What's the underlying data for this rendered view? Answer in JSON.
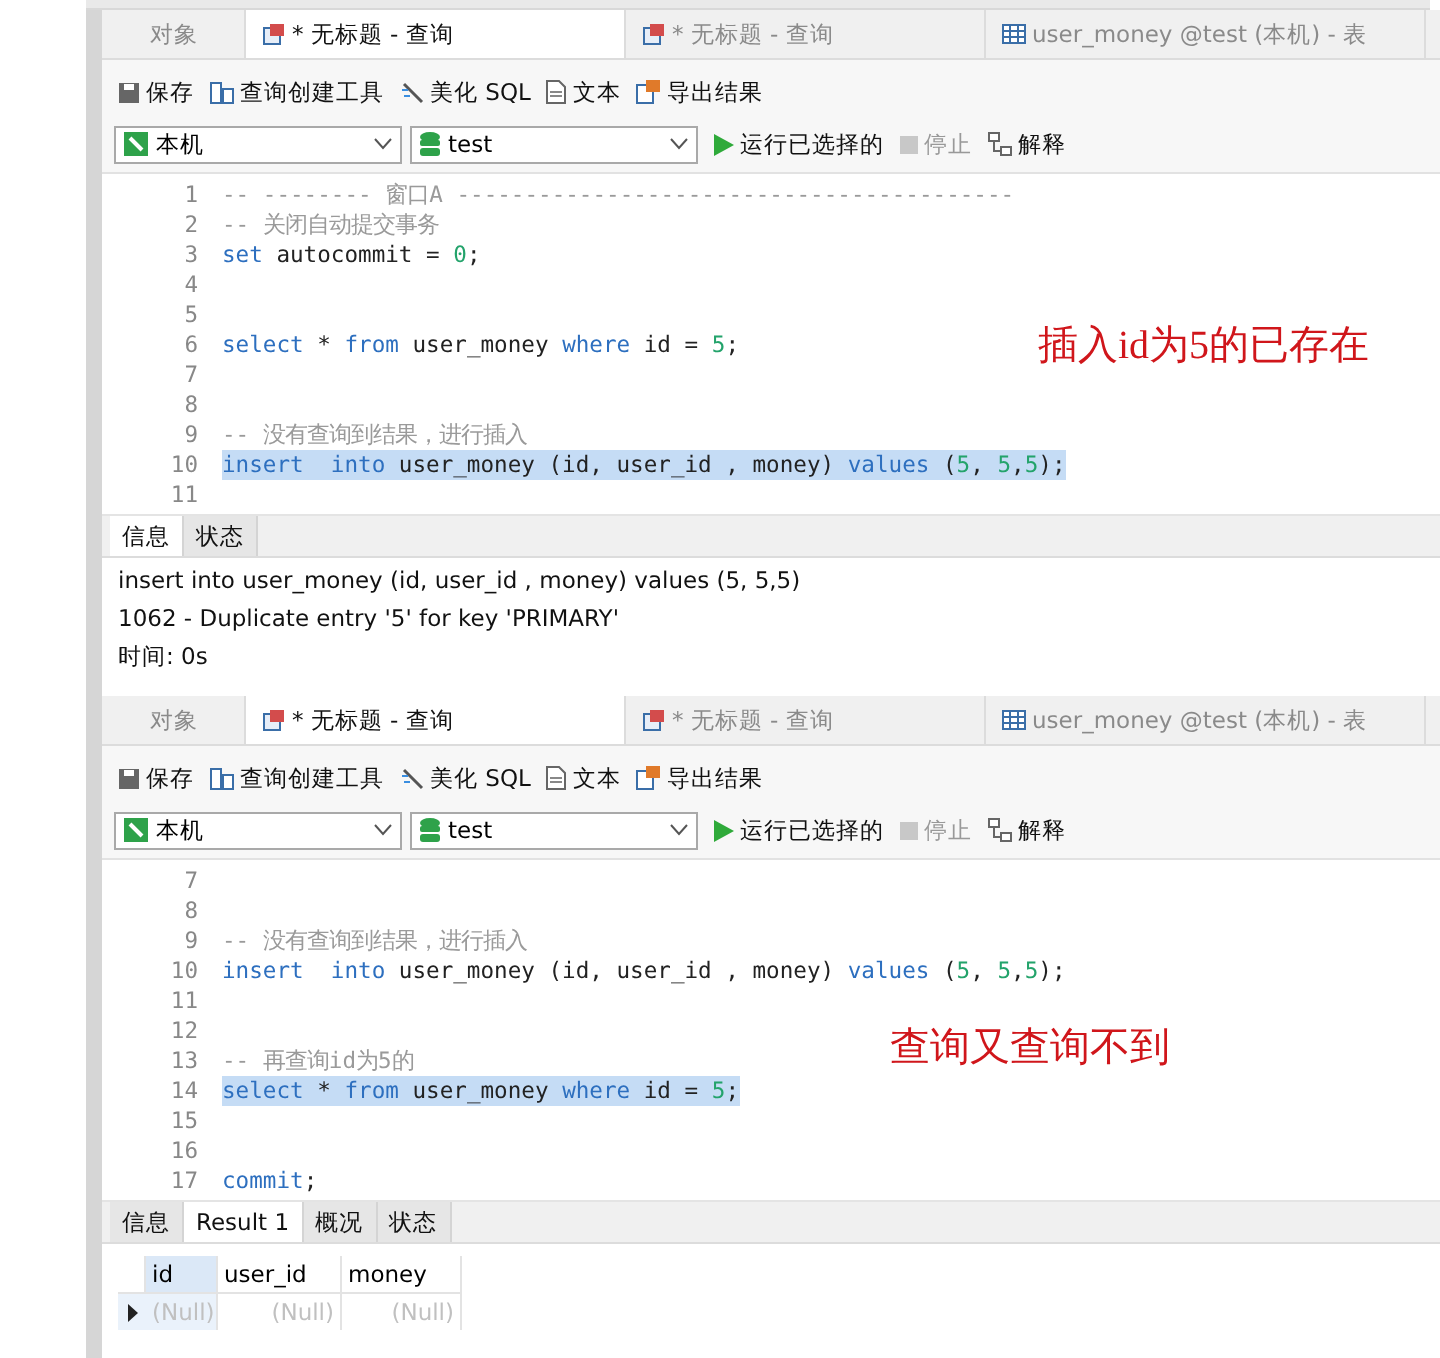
{
  "panels": [
    {
      "tabs": [
        {
          "label": "对象",
          "selected": false,
          "kind": "plain"
        },
        {
          "label": "* 无标题 - 查询",
          "selected": true,
          "kind": "query"
        },
        {
          "label": "* 无标题 - 查询",
          "selected": false,
          "kind": "query"
        },
        {
          "label": "user_money @test (本机) - 表",
          "selected": false,
          "kind": "table"
        }
      ],
      "toolbar": [
        {
          "label": "保存",
          "kind": "save"
        },
        {
          "label": "查询创建工具",
          "kind": "builder"
        },
        {
          "label": "美化 SQL",
          "kind": "beautify"
        },
        {
          "label": "文本",
          "kind": "text"
        },
        {
          "label": "导出结果",
          "kind": "export"
        }
      ],
      "connection": "本机",
      "database": "test",
      "actions": [
        {
          "label": "运行已选择的",
          "kind": "run",
          "disabled": false
        },
        {
          "label": "停止",
          "kind": "stop",
          "disabled": true
        },
        {
          "label": "解释",
          "kind": "explain",
          "disabled": false
        }
      ],
      "lines": [
        {
          "number": "1",
          "selected": false,
          "tokens": [
            {
              "kind": "comment",
              "text": "-- -------- 窗口A -----------------------------------------"
            }
          ]
        },
        {
          "number": "2",
          "selected": false,
          "tokens": [
            {
              "kind": "comment",
              "text": "-- 关闭自动提交事务"
            }
          ]
        },
        {
          "number": "3",
          "selected": false,
          "tokens": [
            {
              "kind": "keyword",
              "text": "set"
            },
            {
              "kind": "plain",
              "text": " autocommit = "
            },
            {
              "kind": "number",
              "text": "0"
            },
            {
              "kind": "plain",
              "text": ";"
            }
          ]
        },
        {
          "number": "4",
          "selected": false
        },
        {
          "number": "5",
          "selected": false
        },
        {
          "number": "6",
          "selected": false,
          "tokens": [
            {
              "kind": "keyword",
              "text": "select"
            },
            {
              "kind": "plain",
              "text": " * "
            },
            {
              "kind": "keyword",
              "text": "from"
            },
            {
              "kind": "plain",
              "text": " user_money "
            },
            {
              "kind": "keyword",
              "text": "where"
            },
            {
              "kind": "plain",
              "text": " id = "
            },
            {
              "kind": "number",
              "text": "5"
            },
            {
              "kind": "plain",
              "text": ";"
            }
          ]
        },
        {
          "number": "7",
          "selected": false
        },
        {
          "number": "8",
          "selected": false
        },
        {
          "number": "9",
          "selected": false,
          "tokens": [
            {
              "kind": "comment",
              "text": "-- 没有查询到结果，进行插入"
            }
          ]
        },
        {
          "number": "10",
          "selected": true,
          "tokens": [
            {
              "kind": "keyword",
              "text": "insert  into"
            },
            {
              "kind": "plain",
              "text": " user_money (id, user_id , money) "
            },
            {
              "kind": "keyword",
              "text": "values"
            },
            {
              "kind": "plain",
              "text": " ("
            },
            {
              "kind": "number",
              "text": "5"
            },
            {
              "kind": "plain",
              "text": ", "
            },
            {
              "kind": "number",
              "text": "5"
            },
            {
              "kind": "plain",
              "text": ","
            },
            {
              "kind": "number",
              "text": "5"
            },
            {
              "kind": "plain",
              "text": ");"
            }
          ]
        },
        {
          "number": "11",
          "selected": false
        }
      ],
      "annotation": "插入id为5的已存在",
      "result_tabs": [
        {
          "label": "信息",
          "selected": true
        },
        {
          "label": "状态",
          "selected": false
        }
      ],
      "result": {
        "kind": "messages",
        "lines": [
          "insert  into user_money (id, user_id , money) values (5, 5,5)",
          "1062 - Duplicate entry '5' for key 'PRIMARY'",
          "时间: 0s"
        ]
      }
    },
    {
      "tabs": [
        {
          "label": "对象",
          "selected": false,
          "kind": "plain"
        },
        {
          "label": "* 无标题 - 查询",
          "selected": true,
          "kind": "query"
        },
        {
          "label": "* 无标题 - 查询",
          "selected": false,
          "kind": "query"
        },
        {
          "label": "user_money @test (本机) - 表",
          "selected": false,
          "kind": "table"
        }
      ],
      "toolbar": [
        {
          "label": "保存",
          "kind": "save"
        },
        {
          "label": "查询创建工具",
          "kind": "builder"
        },
        {
          "label": "美化 SQL",
          "kind": "beautify"
        },
        {
          "label": "文本",
          "kind": "text"
        },
        {
          "label": "导出结果",
          "kind": "export"
        }
      ],
      "connection": "本机",
      "database": "test",
      "actions": [
        {
          "label": "运行已选择的",
          "kind": "run",
          "disabled": false
        },
        {
          "label": "停止",
          "kind": "stop",
          "disabled": true
        },
        {
          "label": "解释",
          "kind": "explain",
          "disabled": false
        }
      ],
      "lines": [
        {
          "number": "7",
          "selected": false
        },
        {
          "number": "8",
          "selected": false
        },
        {
          "number": "9",
          "selected": false,
          "tokens": [
            {
              "kind": "comment",
              "text": "-- 没有查询到结果，进行插入"
            }
          ]
        },
        {
          "number": "10",
          "selected": false,
          "tokens": [
            {
              "kind": "keyword",
              "text": "insert  into"
            },
            {
              "kind": "plain",
              "text": " user_money (id, user_id , money) "
            },
            {
              "kind": "keyword",
              "text": "values"
            },
            {
              "kind": "plain",
              "text": " ("
            },
            {
              "kind": "number",
              "text": "5"
            },
            {
              "kind": "plain",
              "text": ", "
            },
            {
              "kind": "number",
              "text": "5"
            },
            {
              "kind": "plain",
              "text": ","
            },
            {
              "kind": "number",
              "text": "5"
            },
            {
              "kind": "plain",
              "text": ");"
            }
          ]
        },
        {
          "number": "11",
          "selected": false
        },
        {
          "number": "12",
          "selected": false
        },
        {
          "number": "13",
          "selected": false,
          "tokens": [
            {
              "kind": "comment",
              "text": "-- 再查询id为5的"
            }
          ]
        },
        {
          "number": "14",
          "selected": true,
          "tokens": [
            {
              "kind": "keyword",
              "text": "select"
            },
            {
              "kind": "plain",
              "text": " * "
            },
            {
              "kind": "keyword",
              "text": "from"
            },
            {
              "kind": "plain",
              "text": " user_money "
            },
            {
              "kind": "keyword",
              "text": "where"
            },
            {
              "kind": "plain",
              "text": " id = "
            },
            {
              "kind": "number",
              "text": "5"
            },
            {
              "kind": "plain",
              "text": ";"
            }
          ]
        },
        {
          "number": "15",
          "selected": false
        },
        {
          "number": "16",
          "selected": false
        },
        {
          "number": "17",
          "selected": false,
          "tokens": [
            {
              "kind": "keyword",
              "text": "commit"
            },
            {
              "kind": "plain",
              "text": ";"
            }
          ]
        }
      ],
      "annotation": "查询又查询不到",
      "result_tabs": [
        {
          "label": "信息",
          "selected": false
        },
        {
          "label": "Result 1",
          "selected": true
        },
        {
          "label": "概况",
          "selected": false
        },
        {
          "label": "状态",
          "selected": false
        }
      ],
      "result": {
        "kind": "grid",
        "columns": [
          "id",
          "user_id",
          "money"
        ],
        "rows": [
          [
            "(Null)",
            "(Null)",
            "(Null)"
          ]
        ]
      }
    }
  ]
}
